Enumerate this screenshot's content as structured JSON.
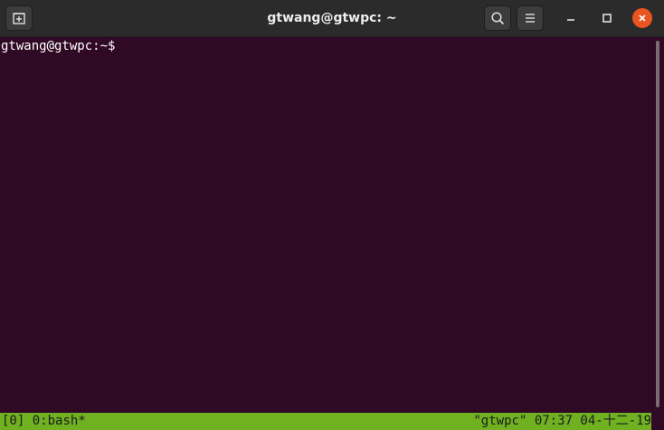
{
  "window": {
    "title": "gtwang@gtwpc: ~"
  },
  "titlebar": {
    "new_tab_icon": "new-tab-icon",
    "search_icon": "search-icon",
    "menu_icon": "hamburger-menu-icon",
    "minimize_icon": "minimize-icon",
    "maximize_icon": "maximize-icon",
    "close_icon": "close-icon"
  },
  "terminal": {
    "prompt": "gtwang@gtwpc:~$ "
  },
  "tmux_status": {
    "session": "[0]",
    "window": "0:bash*",
    "host": "\"gtwpc\"",
    "time": "07:37",
    "date": "04-十二-19"
  },
  "colors": {
    "terminal_bg": "#300a24",
    "titlebar_bg": "#2b2b2b",
    "close_button": "#e95420",
    "status_bar": "#6fb121"
  }
}
